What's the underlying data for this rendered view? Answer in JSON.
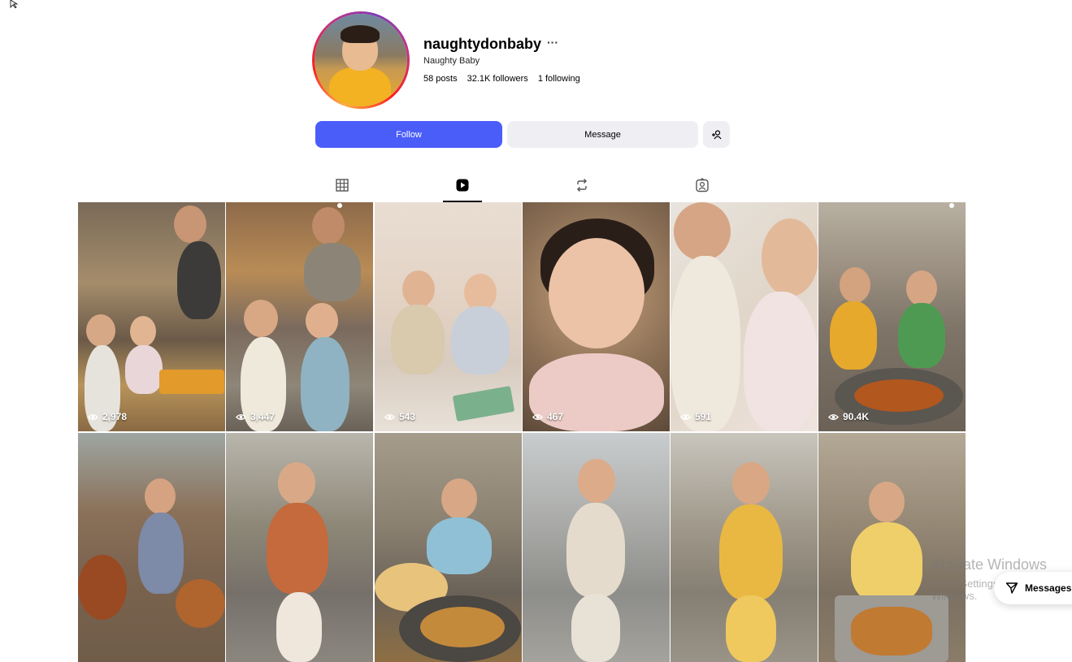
{
  "profile": {
    "username": "naughtydonbaby",
    "more": "···",
    "full_name": "Naughty Baby",
    "posts": "58 posts",
    "followers": "32.1K followers",
    "following": "1 following"
  },
  "actions": {
    "follow": "Follow",
    "message": "Message",
    "add_user": "+⚲"
  },
  "tabs": [
    {
      "name": "posts",
      "icon": "grid-icon",
      "active": false
    },
    {
      "name": "reels",
      "icon": "reels-icon",
      "active": true
    },
    {
      "name": "reposts",
      "icon": "repost-icon",
      "active": false
    },
    {
      "name": "tagged",
      "icon": "tagged-icon",
      "active": false
    }
  ],
  "reels": [
    {
      "views": "2,978"
    },
    {
      "views": "3,447"
    },
    {
      "views": "543"
    },
    {
      "views": "467"
    },
    {
      "views": "591"
    },
    {
      "views": "90.4K"
    },
    {
      "views": ""
    },
    {
      "views": ""
    },
    {
      "views": ""
    },
    {
      "views": ""
    },
    {
      "views": ""
    },
    {
      "views": ""
    }
  ],
  "system": {
    "activate_title": "Activate Windows",
    "activate_sub": "Go to Settings to activate Windows."
  },
  "messages_pill": {
    "label": "Messages"
  }
}
